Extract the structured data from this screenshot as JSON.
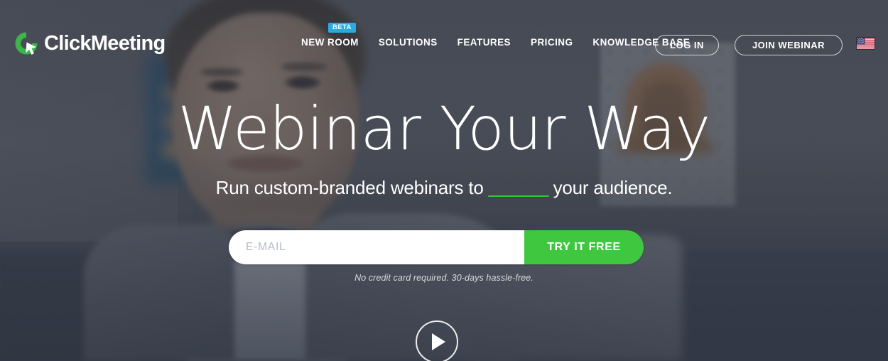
{
  "brand": {
    "name": "ClickMeeting",
    "logo_icon": "clickmeeting-cursor-logo",
    "accent_green": "#3fc83f",
    "beta_blue": "#29abe2"
  },
  "header": {
    "nav": [
      {
        "label": "NEW ROOM",
        "badge": "BETA"
      },
      {
        "label": "SOLUTIONS",
        "badge": ""
      },
      {
        "label": "FEATURES",
        "badge": ""
      },
      {
        "label": "PRICING",
        "badge": ""
      },
      {
        "label": "KNOWLEDGE BASE",
        "badge": ""
      }
    ],
    "login_label": "LOG IN",
    "join_label": "JOIN WEBINAR",
    "language_flag": "us-flag-icon"
  },
  "hero": {
    "headline": "Webinar Your Way",
    "sub_before": "Run custom-branded webinars to",
    "sub_typed": "",
    "sub_after": "your audience.",
    "underline_color": "#35c43b"
  },
  "form": {
    "email_placeholder": "E-MAIL",
    "email_value": "",
    "cta_label": "TRY IT FREE",
    "disclaimer": "No credit card required. 30-days hassle-free."
  },
  "video": {
    "play_icon": "play-triangle-icon"
  }
}
